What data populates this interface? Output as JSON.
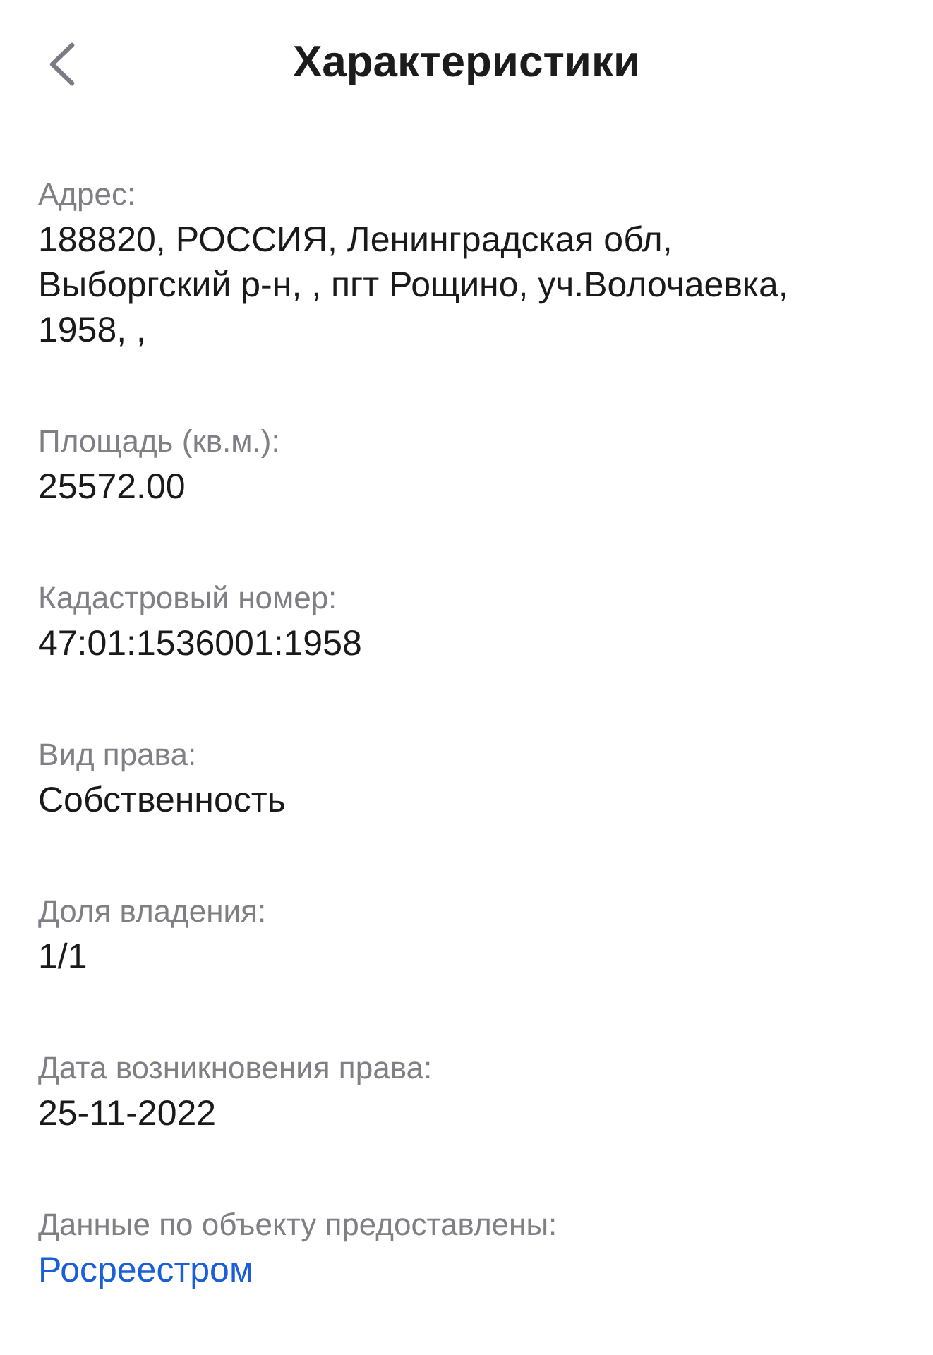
{
  "header": {
    "title": "Характеристики"
  },
  "fields": [
    {
      "label": "Адрес:",
      "value": "188820, РОССИЯ, Ленинградская обл, Выборгский р-н, , пгт Рощино, уч.Волочаевка, 1958, ,",
      "kind": "text"
    },
    {
      "label": "Площадь (кв.м.):",
      "value": "25572.00",
      "kind": "text"
    },
    {
      "label": "Кадастровый номер:",
      "value": "47:01:1536001:1958",
      "kind": "text"
    },
    {
      "label": "Вид права:",
      "value": "Собственность",
      "kind": "text"
    },
    {
      "label": "Доля владения:",
      "value": "1/1",
      "kind": "text"
    },
    {
      "label": "Дата возникновения права:",
      "value": "25-11-2022",
      "kind": "text"
    },
    {
      "label": "Данные по объекту предоставлены:",
      "value": "Росреестром",
      "kind": "link"
    }
  ]
}
